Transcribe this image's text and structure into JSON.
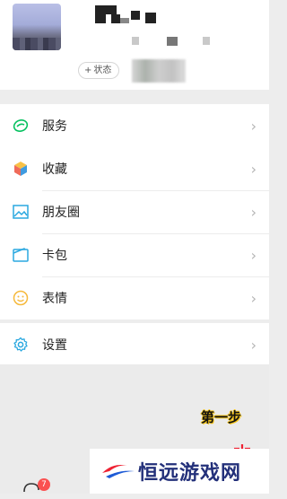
{
  "profile": {
    "status_button": "状态",
    "status_plus": "+"
  },
  "menu": {
    "services": {
      "label": "服务",
      "icon": "services-icon",
      "color": "#07c160"
    },
    "favorites": {
      "label": "收藏",
      "icon": "cube-icon"
    },
    "moments": {
      "label": "朋友圈",
      "icon": "image-icon",
      "color": "#2aa8e0"
    },
    "cards": {
      "label": "卡包",
      "icon": "card-wallet-icon",
      "color": "#2aa8e0"
    },
    "stickers": {
      "label": "表情",
      "icon": "smile-icon",
      "color": "#f6b93b"
    },
    "settings": {
      "label": "设置",
      "icon": "gear-icon",
      "color": "#2aa8e0"
    }
  },
  "chevron": "›",
  "overlay": {
    "step_label": "第一步",
    "watermark_text": "恒远游戏网"
  },
  "tabbar": {
    "chat_badge": "7"
  }
}
